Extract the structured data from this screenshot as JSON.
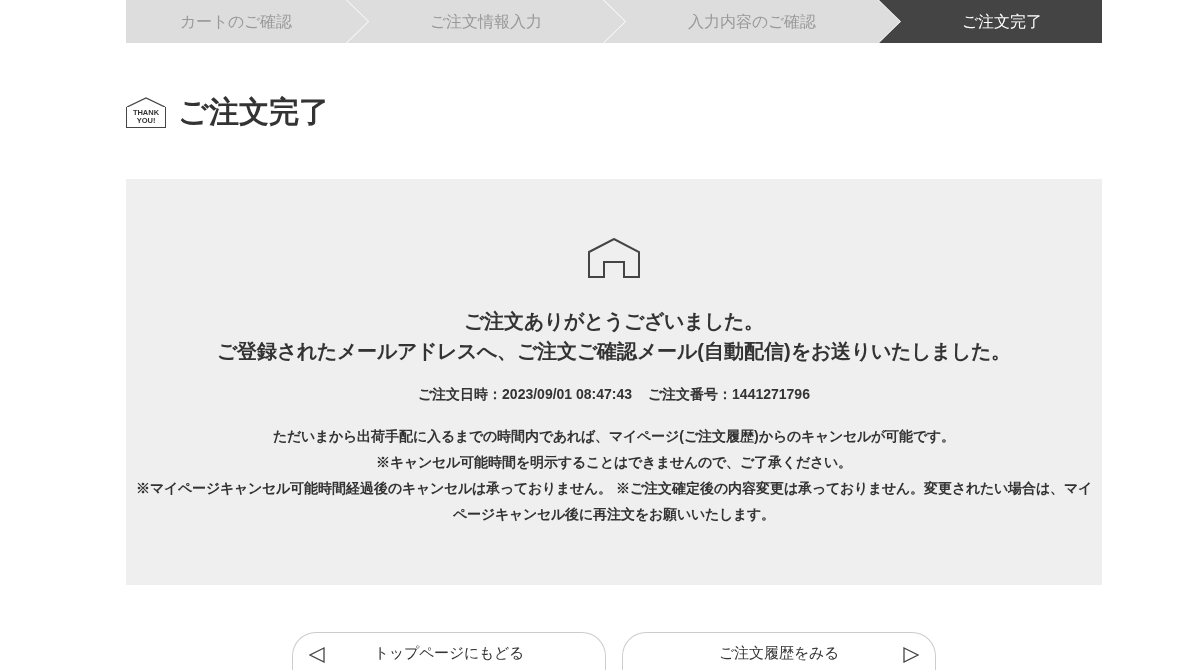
{
  "steps": [
    {
      "label": "カートのご確認",
      "selected": false
    },
    {
      "label": "ご注文情報入力",
      "selected": false
    },
    {
      "label": "入力内容のご確認",
      "selected": false
    },
    {
      "label": "ご注文完了",
      "selected": true
    }
  ],
  "page_title": {
    "badge": [
      "THANK",
      "YOU!"
    ],
    "text": "ご注文完了"
  },
  "message_panel": {
    "headline": [
      "ご注文ありがとうございました。",
      "ご登録されたメールアドレスへ、ご注文ご確認メール(自動配信)をお送りいたしました。"
    ],
    "order_info": [
      "ご注文日時：2023/09/01 08:47:43",
      "ご注文番号：1441271796"
    ],
    "notes": [
      "ただいまから出荷手配に入るまでの時間内であれば、マイページ(ご注文履歴)からのキャンセルが可能です。",
      "※キャンセル可能時間を明示することはできませんので、ご了承ください。",
      "※マイページキャンセル可能時間経過後のキャンセルは承っておりません。 ※ご注文確定後の内容変更は承っておりません。変更されたい場合は、マイページキャンセル後に再注文をお願いいたします。"
    ]
  },
  "buttons": [
    {
      "label": "トップページにもどる",
      "kind": "back"
    },
    {
      "label": "ご注文履歴をみる",
      "kind": "forward"
    }
  ]
}
